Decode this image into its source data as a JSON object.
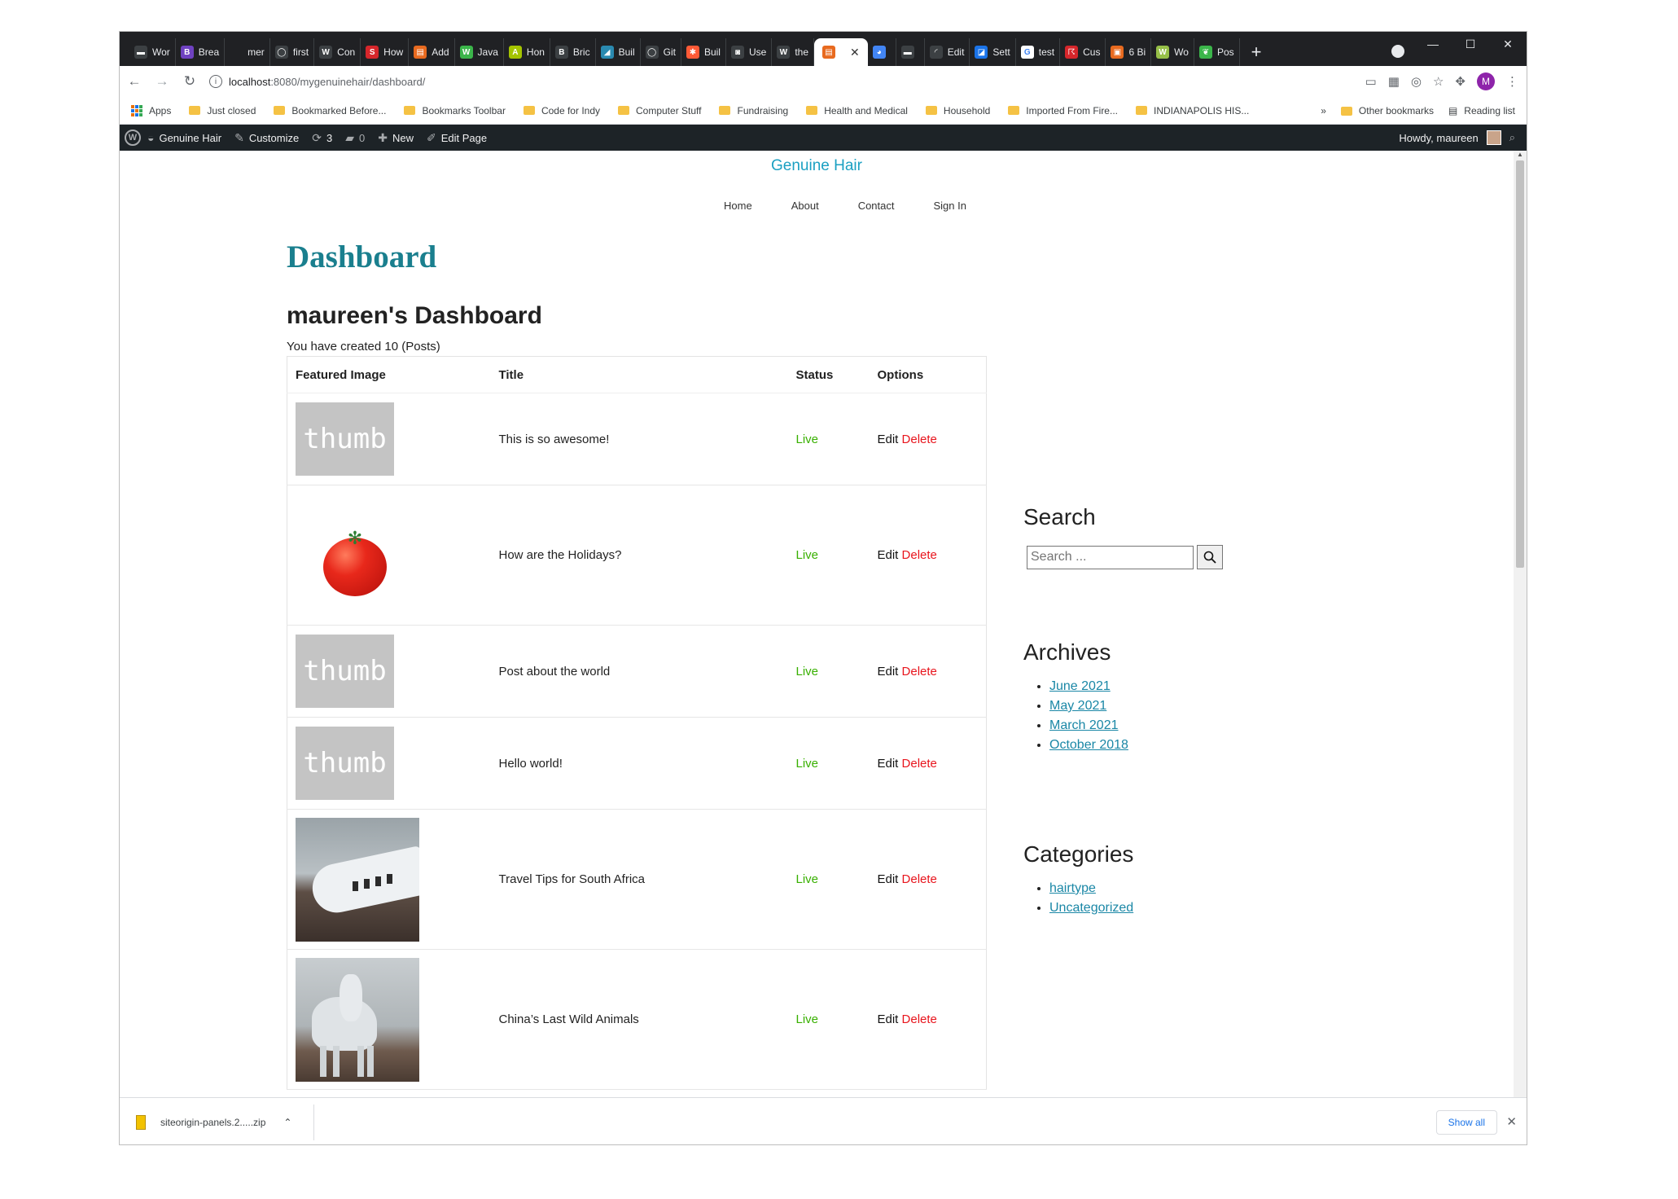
{
  "browser": {
    "tabs": [
      {
        "label": "Wor",
        "color": "#3c4043",
        "glyph": "▬"
      },
      {
        "label": "Brea",
        "color": "#6f42c1",
        "glyph": "B"
      },
      {
        "label": "mer",
        "color": "#202124",
        "glyph": ""
      },
      {
        "label": "first",
        "color": "#3c4043",
        "glyph": "◯"
      },
      {
        "label": "Con",
        "color": "#3c4043",
        "glyph": "W"
      },
      {
        "label": "How",
        "color": "#d6262b",
        "glyph": "S"
      },
      {
        "label": "Add",
        "color": "#e86a1f",
        "glyph": "▤"
      },
      {
        "label": "Java",
        "color": "#3bb54a",
        "glyph": "W"
      },
      {
        "label": "Hon",
        "color": "#a4c400",
        "glyph": "A"
      },
      {
        "label": "Bric",
        "color": "#3c4043",
        "glyph": "B"
      },
      {
        "label": "Buil",
        "color": "#2a8ab0",
        "glyph": "◢"
      },
      {
        "label": "Git",
        "color": "#3c4043",
        "glyph": "◯"
      },
      {
        "label": "Buil",
        "color": "#ff5a36",
        "glyph": "✱"
      },
      {
        "label": "Use",
        "color": "#3c4043",
        "glyph": "◙"
      },
      {
        "label": "the",
        "color": "#3c4043",
        "glyph": "W"
      },
      {
        "label": "",
        "color": "#e86a1f",
        "glyph": "▤",
        "active": true
      },
      {
        "label": "",
        "color": "#4285f4",
        "glyph": "◕"
      },
      {
        "label": "",
        "color": "#3c4043",
        "glyph": "▬"
      },
      {
        "label": "Edit",
        "color": "#3c4043",
        "glyph": "◜"
      },
      {
        "label": "Sett",
        "color": "#1a73e8",
        "glyph": "◪"
      },
      {
        "label": "test",
        "color": "#ffffff",
        "glyph": "G"
      },
      {
        "label": "Cus",
        "color": "#d6262b",
        "glyph": "☈"
      },
      {
        "label": "6 Bi",
        "color": "#e86a1f",
        "glyph": "▣"
      },
      {
        "label": "Wo",
        "color": "#96bf48",
        "glyph": "W"
      },
      {
        "label": "Pos",
        "color": "#3bb54a",
        "glyph": "❦"
      }
    ],
    "url_host": "localhost",
    "url_rest": ":8080/mygenuinehair/dashboard/",
    "avatar_letter": "M",
    "bookmarks": [
      "Apps",
      "Just closed",
      "Bookmarked Before...",
      "Bookmarks Toolbar",
      "Code for Indy",
      "Computer Stuff",
      "Fundraising",
      "Health and Medical",
      "Household",
      "Imported From Fire...",
      "INDIANAPOLIS HIS..."
    ],
    "bookmarks_right": {
      "more": "»",
      "other": "Other bookmarks",
      "reading": "Reading list"
    }
  },
  "wpbar": {
    "site": "Genuine Hair",
    "customize": "Customize",
    "updates": "3",
    "comments": "0",
    "new": "New",
    "edit_page": "Edit Page",
    "howdy": "Howdy, maureen"
  },
  "site": {
    "title": "Genuine Hair",
    "nav": [
      "Home",
      "About",
      "Contact",
      "Sign In"
    ]
  },
  "dashboard": {
    "heading": "Dashboard",
    "subheading": "maureen's Dashboard",
    "created_text": "You have created 10 (Posts)",
    "columns": [
      "Featured Image",
      "Title",
      "Status",
      "Options"
    ],
    "edit_label": "Edit",
    "delete_label": "Delete",
    "thumb_text": "thumb",
    "rows": [
      {
        "image": "thumb",
        "title": "This is so awesome!",
        "status": "Live"
      },
      {
        "image": "tomato",
        "title": "How are the Holidays?",
        "status": "Live"
      },
      {
        "image": "thumb",
        "title": "Post about the world",
        "status": "Live"
      },
      {
        "image": "thumb",
        "title": "Hello world!",
        "status": "Live"
      },
      {
        "image": "plane",
        "title": "Travel Tips for South Africa",
        "status": "Live"
      },
      {
        "image": "horse",
        "title": "China’s Last Wild Animals",
        "status": "Live"
      }
    ]
  },
  "sidebar": {
    "search_title": "Search",
    "search_placeholder": "Search ...",
    "archives_title": "Archives",
    "archives": [
      "June 2021",
      "May 2021",
      "March 2021",
      "October 2018"
    ],
    "categories_title": "Categories",
    "categories": [
      "hairtype",
      "Uncategorized"
    ]
  },
  "downloads": {
    "file": "siteorigin-panels.2.....zip",
    "show_all": "Show all"
  },
  "colors": {
    "accent": "#1ba0c2",
    "heading": "#1a7f8e",
    "live": "#38b000",
    "delete": "#e8141c",
    "link": "#1a87a6"
  }
}
